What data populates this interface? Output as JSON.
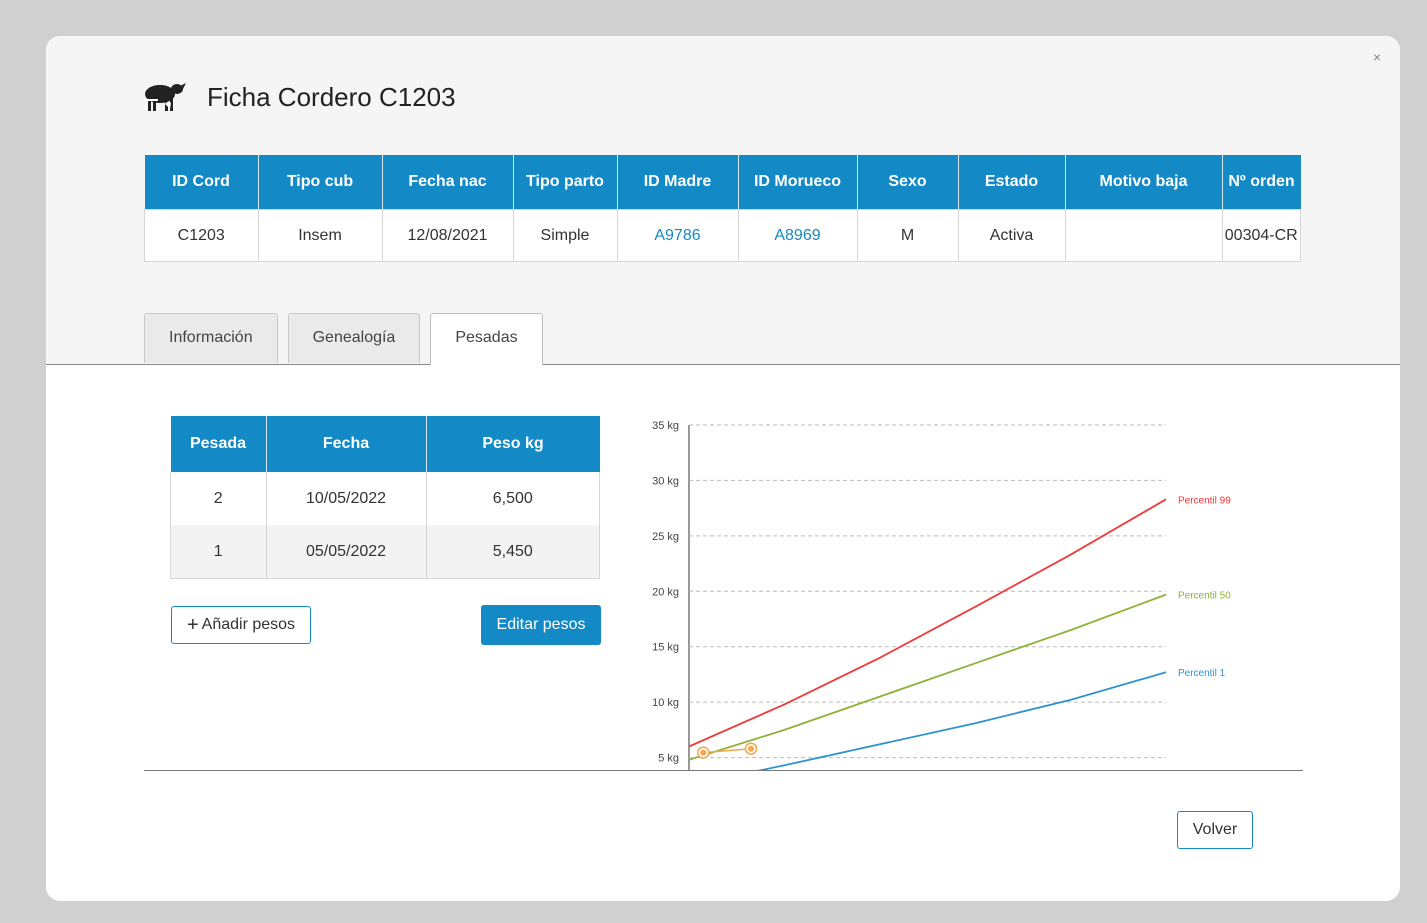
{
  "modal": {
    "title": "Ficha Cordero C1203",
    "close_icon": "close-icon"
  },
  "header_table": {
    "columns": [
      "ID Cord",
      "Tipo cub",
      "Fecha nac",
      "Tipo parto",
      "ID Madre",
      "ID Morueco",
      "Sexo",
      "Estado",
      "Motivo baja",
      "Nº orden"
    ],
    "row": [
      "C1203",
      "Insem",
      "12/08/2021",
      "Simple",
      "A9786",
      "A8969",
      "M",
      "Activa",
      "",
      "00304-CR"
    ]
  },
  "tabs": [
    {
      "label": "Información",
      "active": false
    },
    {
      "label": "Genealogía",
      "active": false
    },
    {
      "label": "Pesadas",
      "active": true
    }
  ],
  "weights_table": {
    "columns": [
      "Pesada",
      "Fecha",
      "Peso kg"
    ],
    "rows": [
      [
        "2",
        "10/05/2022",
        "6,500"
      ],
      [
        "1",
        "05/05/2022",
        "5,450"
      ]
    ]
  },
  "buttons": {
    "add_label": "Añadir pesos",
    "edit_label": "Editar pesos",
    "back_label": "Volver"
  },
  "colors": {
    "accent": "#1389c5",
    "p99": "#f0393a",
    "p50": "#8db23a",
    "p1": "#2c93cf",
    "points": "#f3a64a"
  },
  "chart_data": {
    "type": "line",
    "yticks": [
      "5 kg",
      "10 kg",
      "15 kg",
      "20 kg",
      "25 kg",
      "30 kg",
      "35 kg"
    ],
    "ylim": [
      0,
      35
    ],
    "xlim": [
      0,
      100
    ],
    "grid": true,
    "series": [
      {
        "name": "Percentil 99",
        "x": [
          0,
          20,
          40,
          60,
          80,
          100
        ],
        "values": [
          6.0,
          9.8,
          14.0,
          18.6,
          23.3,
          28.3
        ]
      },
      {
        "name": "Percentil 50",
        "x": [
          0,
          20,
          40,
          60,
          80,
          100
        ],
        "values": [
          4.8,
          7.5,
          10.5,
          13.5,
          16.5,
          19.7
        ]
      },
      {
        "name": "Percentil 1",
        "x": [
          0,
          20,
          40,
          60,
          80,
          100
        ],
        "values": [
          2.5,
          4.3,
          6.2,
          8.1,
          10.2,
          12.7
        ]
      }
    ],
    "points": {
      "x": [
        3,
        13
      ],
      "values": [
        5.45,
        5.8
      ]
    }
  }
}
